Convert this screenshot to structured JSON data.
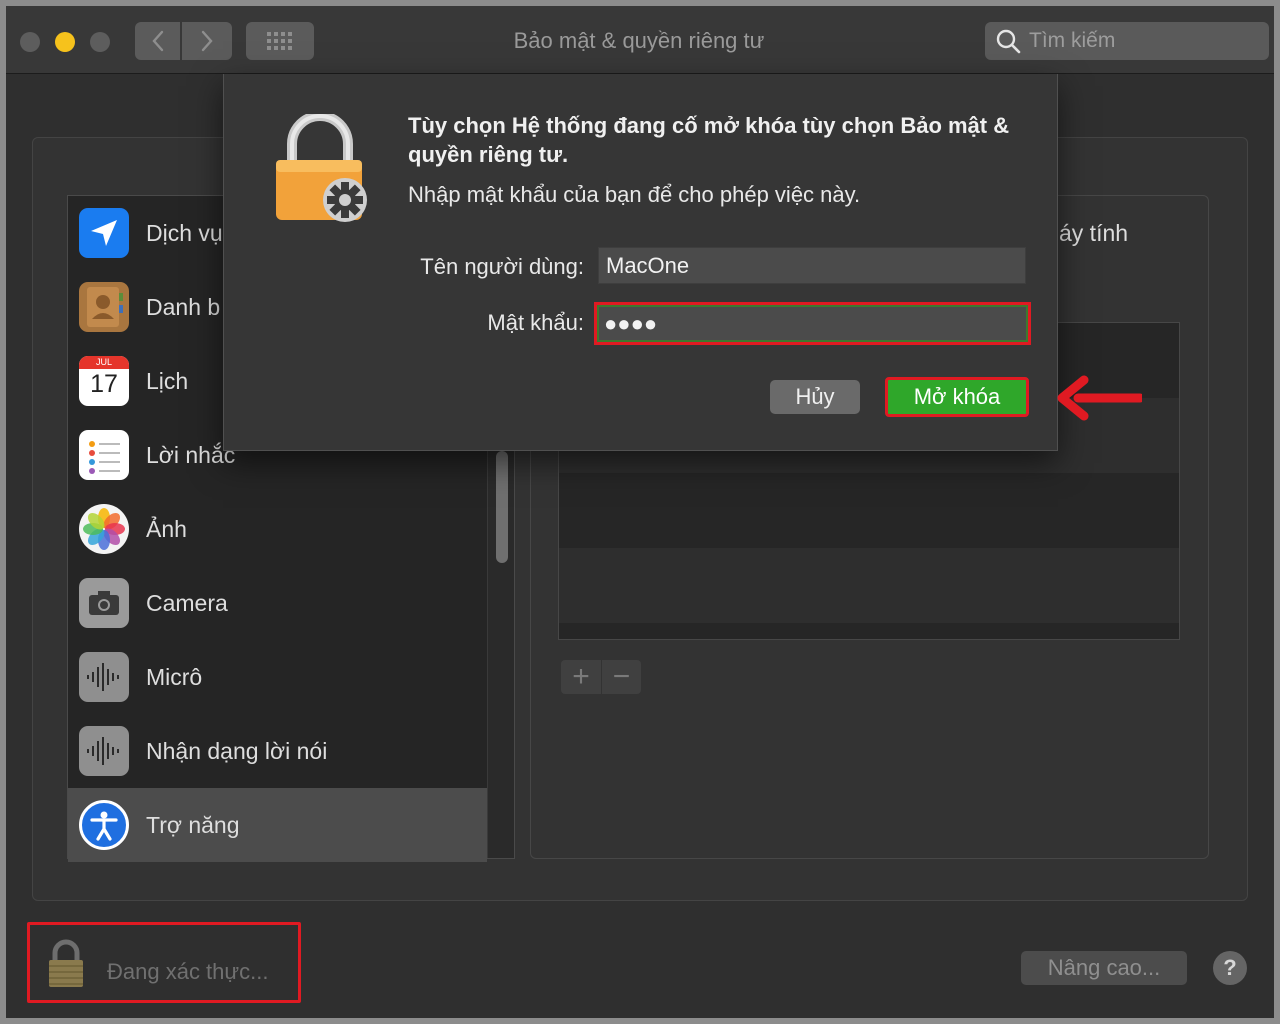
{
  "window": {
    "title": "Bảo mật & quyền riêng tư",
    "search_placeholder": "Tìm kiếm"
  },
  "sidebar": {
    "items": [
      {
        "label": "Dịch vụ",
        "icon": "location-arrow-icon"
      },
      {
        "label": "Danh b",
        "icon": "contacts-book-icon"
      },
      {
        "label": "Lịch",
        "icon": "calendar-icon",
        "month": "JUL",
        "day": "17"
      },
      {
        "label": "Lời nhắc",
        "icon": "reminders-icon"
      },
      {
        "label": "Ảnh",
        "icon": "photos-flower-icon"
      },
      {
        "label": "Camera",
        "icon": "camera-icon"
      },
      {
        "label": "Micrô",
        "icon": "microphone-waveform-icon"
      },
      {
        "label": "Nhận dạng lời nói",
        "icon": "speech-waveform-icon"
      },
      {
        "label": "Trợ năng",
        "icon": "accessibility-icon",
        "selected": true
      }
    ]
  },
  "right_pane": {
    "partial_label": "áy tính"
  },
  "dialog": {
    "title": "Tùy chọn Hệ thống đang cố mở khóa tùy chọn Bảo mật & quyền riêng tư.",
    "message": "Nhập mật khẩu của bạn để cho phép việc này.",
    "username_label": "Tên người dùng:",
    "username_value": "MacOne",
    "password_label": "Mật khẩu:",
    "password_value": "●●●●",
    "cancel_label": "Hủy",
    "unlock_label": "Mở khóa"
  },
  "footer": {
    "auth_status": "Đang xác thực...",
    "advanced_label": "Nâng cao...",
    "help_label": "?"
  },
  "colors": {
    "highlight_red": "#e01a22",
    "unlock_green": "#2fa72a",
    "window_bg": "#2f2f2f"
  }
}
